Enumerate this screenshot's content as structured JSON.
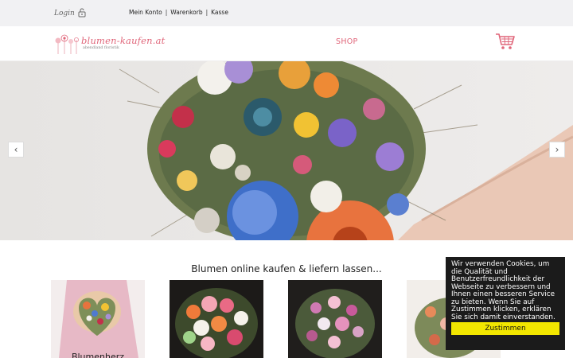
{
  "topbar": {
    "login_label": "Login",
    "links": [
      "Mein Konto",
      "Warenkorb",
      "Kasse"
    ],
    "separator": "|"
  },
  "header": {
    "logo_text": "blumen-kaufen.at",
    "logo_subtitle": "abendland floristik",
    "shop_label": "SHOP"
  },
  "hero": {
    "prev_label": "‹",
    "next_label": "›"
  },
  "products": {
    "section_title": "Blumen online kaufen & liefern lassen...",
    "items": [
      {
        "name": "Blumenherz"
      },
      {
        "name": ""
      },
      {
        "name": ""
      },
      {
        "name": ""
      }
    ]
  },
  "cookie": {
    "text": "Wir verwenden Cookies, um die Qualität und Benutzerfreundlichkeit der Webseite zu verbessern und Ihnen einen besseren Service zu bieten. Wenn Sie auf Zustimmen klicken, erklären Sie sich damit einverstanden.",
    "button_label": "Zustimmen"
  },
  "colors": {
    "brand_pink": "#e0667a",
    "topbar_bg": "#f1f1f3",
    "cookie_bg": "#1b1b1b",
    "cookie_button": "#f2e600"
  }
}
